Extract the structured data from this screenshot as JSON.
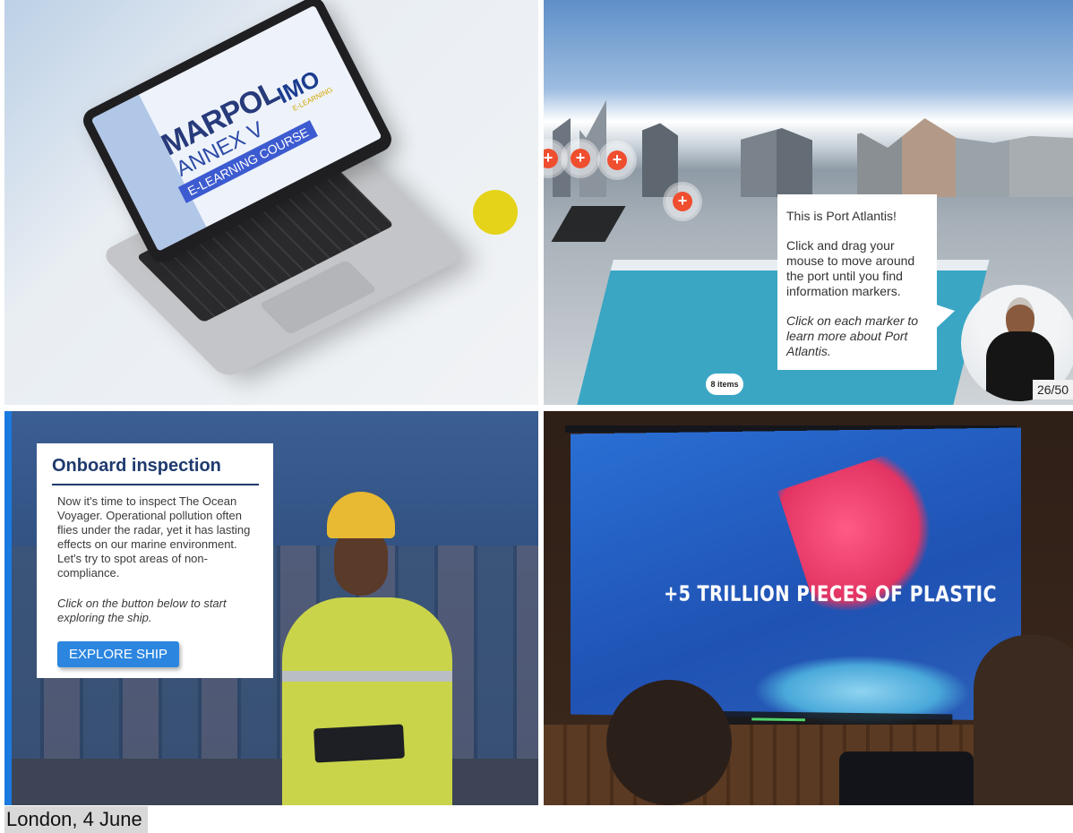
{
  "panel1": {
    "screen_title": "MARPOL",
    "screen_subtitle": "ANNEX V",
    "screen_course": "E-LEARNING COURSE",
    "logo_text": "IMO",
    "logo_sub": "E-LEARNING"
  },
  "panel2": {
    "info_heading": "This is Port Atlantis!",
    "info_body": "Click and drag your mouse to move around the port until you find information markers.",
    "info_italic": "Click on each marker to learn more about Port Atlantis.",
    "items_pill": "8 items",
    "page_counter": "26/50",
    "marker_symbol": "+"
  },
  "panel3": {
    "title": "Onboard inspection",
    "body": "Now it's time to inspect The Ocean Voyager. Operational pollution often flies under the radar, yet it has lasting effects on our marine environment. Let's try to spot areas of non-compliance.",
    "italic": "Click on the button below to start exploring the ship.",
    "button_label": "EXPLORE SHIP"
  },
  "panel4": {
    "screen_text": "+5 TRILLION PIECES OF PLASTIC"
  },
  "caption": "London, 4 June",
  "colors": {
    "accent_blue": "#2c86e0",
    "marker_red": "#ef4e2f",
    "title_navy": "#1e3a6e",
    "yellow_dot": "#e4d319"
  }
}
